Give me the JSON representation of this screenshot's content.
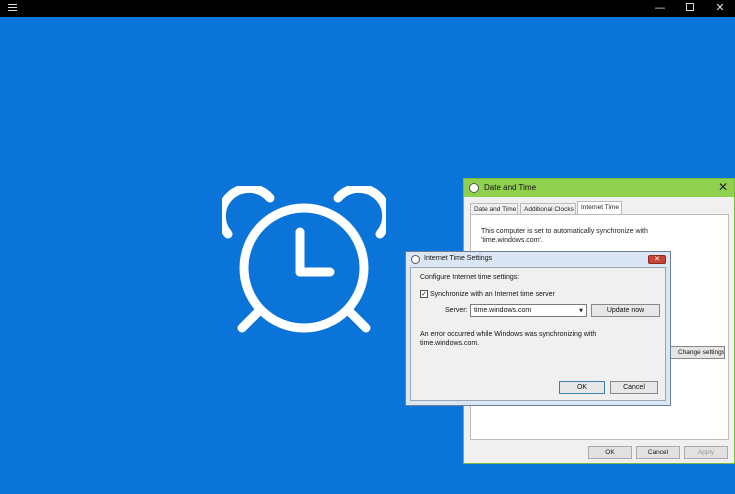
{
  "app": {
    "window_controls": {
      "minimize": "—",
      "close": "✕"
    }
  },
  "date_time_dialog": {
    "title": "Date and Time",
    "tabs": [
      "Date and Time",
      "Additional Clocks",
      "Internet Time"
    ],
    "active_tab": "Internet Time",
    "panel_text": "This computer is set to automatically synchronize with 'time.windows.com'.",
    "change_settings_label": "Change settings...",
    "buttons": {
      "ok": "OK",
      "cancel": "Cancel",
      "apply": "Apply"
    }
  },
  "internet_time_dialog": {
    "title": "Internet Time Settings",
    "heading": "Configure Internet time settings:",
    "sync_label": "Synchronize with an Internet time server",
    "sync_checked": true,
    "server_label": "Server:",
    "server_value": "time.windows.com",
    "update_label": "Update now",
    "error_text": "An error occurred while Windows was synchronizing with time.windows.com.",
    "buttons": {
      "ok": "OK",
      "cancel": "Cancel"
    }
  },
  "colors": {
    "background": "#0a74d9",
    "dialog_title_accent": "#8fd14f"
  }
}
